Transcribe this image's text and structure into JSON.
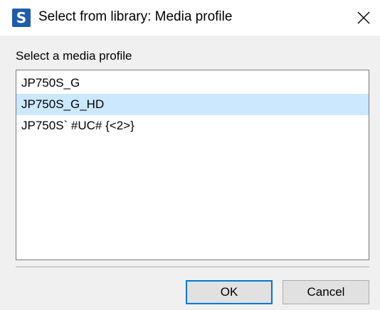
{
  "window": {
    "app_icon_letter": "S",
    "title": "Select from library: Media profile",
    "close_glyph": "close-icon"
  },
  "prompt": {
    "label": "Select a media profile"
  },
  "profiles": {
    "items": [
      {
        "label": "JP750S_G",
        "selected": false
      },
      {
        "label": "JP750S_G_HD",
        "selected": true
      },
      {
        "label": "JP750S` #UC# {<2>}",
        "selected": false
      }
    ]
  },
  "buttons": {
    "ok_label": "OK",
    "cancel_label": "Cancel"
  },
  "colors": {
    "selection": "#cce8ff",
    "default_button_border": "#0078d7",
    "app_icon": "#1f5da8"
  }
}
